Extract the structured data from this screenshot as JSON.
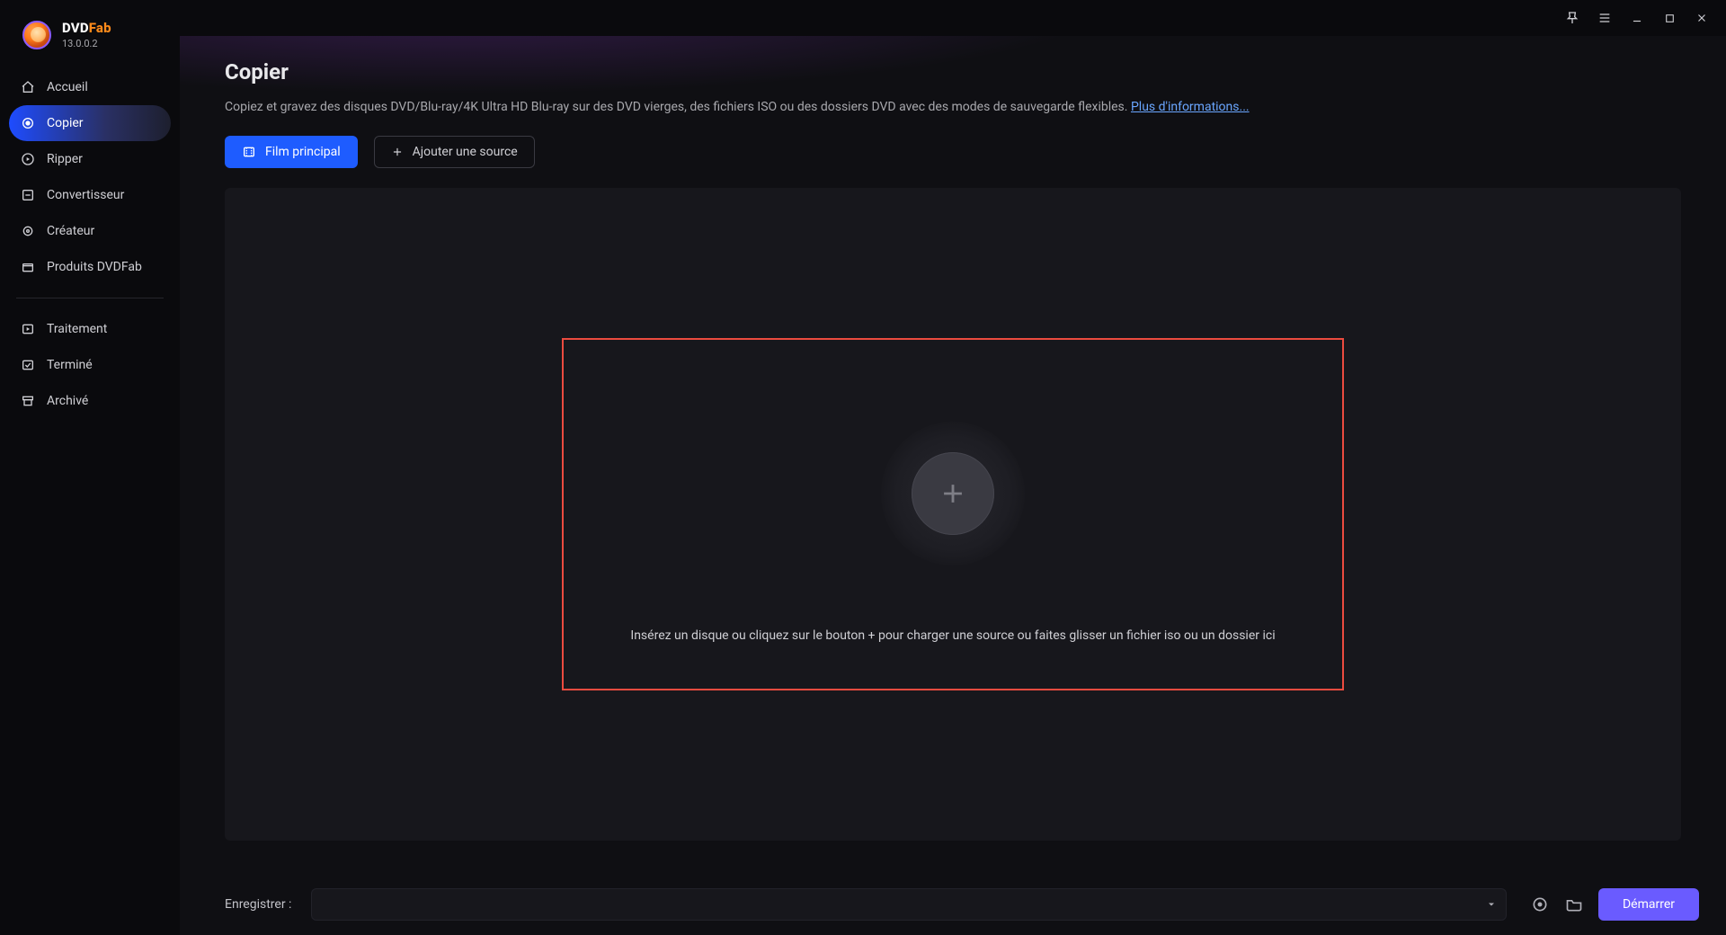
{
  "app": {
    "name_html_main": "DVD",
    "name_html_accent": "Fab",
    "version": "13.0.0.2"
  },
  "sidebar": {
    "items": [
      {
        "label": "Accueil",
        "icon": "home"
      },
      {
        "label": "Copier",
        "icon": "target",
        "active": true
      },
      {
        "label": "Ripper",
        "icon": "disc-play"
      },
      {
        "label": "Convertisseur",
        "icon": "convert"
      },
      {
        "label": "Créateur",
        "icon": "gear"
      },
      {
        "label": "Produits DVDFab",
        "icon": "package"
      }
    ],
    "items2": [
      {
        "label": "Traitement",
        "icon": "play-list"
      },
      {
        "label": "Terminé",
        "icon": "check-list"
      },
      {
        "label": "Archivé",
        "icon": "archive"
      }
    ]
  },
  "header": {
    "title": "Copier",
    "description": "Copiez et gravez des disques DVD/Blu-ray/4K Ultra HD Blu-ray sur des DVD vierges, des fichiers ISO ou des dossiers DVD avec des modes de sauvegarde flexibles. ",
    "more_link": "Plus d'informations..."
  },
  "toolbar": {
    "main_movie": "Film principal",
    "add_source": "Ajouter une source"
  },
  "dropzone": {
    "text": "Insérez un disque ou cliquez sur le bouton +  pour charger une source ou faites glisser un fichier iso ou un dossier ici"
  },
  "footer": {
    "save_label": "Enregistrer :",
    "save_value": "",
    "start": "Démarrer"
  }
}
